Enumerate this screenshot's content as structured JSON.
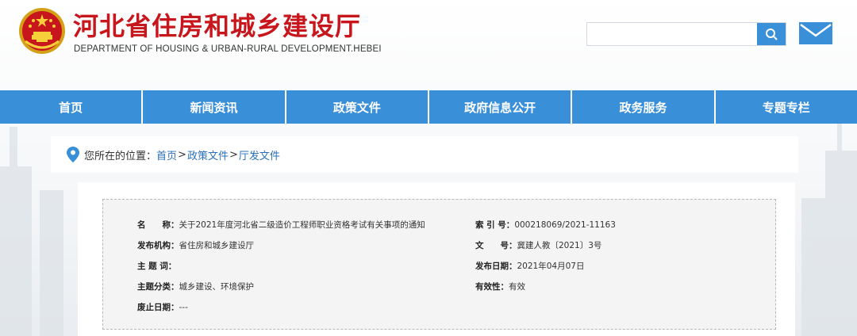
{
  "header": {
    "title": "河北省住房和城乡建设厅",
    "subtitle": "DEPARTMENT OF HOUSING & URBAN-RURAL DEVELOPMENT.HEBEI",
    "search_placeholder": "",
    "emblem_icon": "national-emblem-icon",
    "search_icon": "search-icon",
    "mail_icon": "mail-icon"
  },
  "nav": {
    "items": [
      "首页",
      "新闻资讯",
      "政策文件",
      "政府信息公开",
      "政务服务",
      "专题专栏"
    ]
  },
  "breadcrumb": {
    "prefix": "您所在的位置：",
    "items": [
      "首页",
      "政策文件",
      "厅发文件"
    ],
    "separator": ">"
  },
  "document_meta": {
    "name_label": "名　　称：",
    "name_value": "关于2021年度河北省二级造价工程师职业资格考试有关事项的通知",
    "index_label": "索 引 号：",
    "index_value": "000218069/2021-11163",
    "issuer_label": "发布机构：",
    "issuer_value": "省住房和城乡建设厅",
    "doc_no_label": "文　　号：",
    "doc_no_value": "冀建人教〔2021〕3号",
    "keywords_label": "主 题 词：",
    "keywords_value": "",
    "date_label": "发布日期：",
    "date_value": "2021年04月07日",
    "category_label": "主题分类：",
    "category_value": "城乡建设、环境保护",
    "validity_label": "有效性：",
    "validity_value": "有效",
    "expiry_label": "废止日期：",
    "expiry_value": "---"
  },
  "colors": {
    "brand_red": "#c8161d",
    "nav_blue": "#3a8fd9",
    "link_blue": "#2a6fb8"
  }
}
